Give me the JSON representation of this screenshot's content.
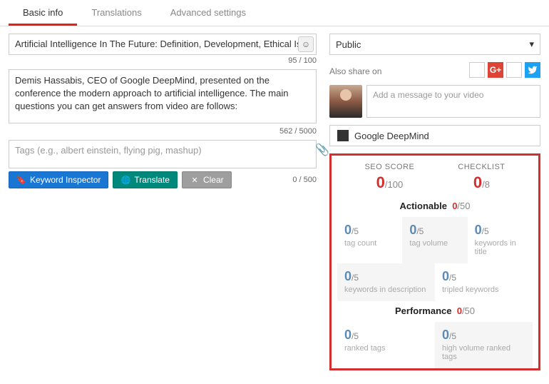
{
  "tabs": {
    "basic": "Basic info",
    "translations": "Translations",
    "advanced": "Advanced settings"
  },
  "title": {
    "value": "Artificial Intelligence In The Future: Definition, Development, Ethical Is",
    "counter": "95 / 100"
  },
  "description": {
    "value": "Demis Hassabis, CEO of Google DeepMind, presented on the conference the modern approach to artificial intelligence. The main questions you can get answers from video are follows:",
    "counter": "562 / 5000"
  },
  "tags": {
    "placeholder": "Tags (e.g., albert einstein, flying pig, mashup)",
    "counter": "0 / 500"
  },
  "buttons": {
    "keyword": "Keyword Inspector",
    "translate": "Translate",
    "clear": "Clear"
  },
  "privacy": {
    "value": "Public"
  },
  "share": {
    "label": "Also share on",
    "msg_placeholder": "Add a message to your video",
    "gplus": "G+",
    "twitter": "t"
  },
  "card": {
    "label": "Google DeepMind"
  },
  "seo": {
    "score_label": "SEO SCORE",
    "score_num": "0",
    "score_den": "/100",
    "check_label": "CHECKLIST",
    "check_num": "0",
    "check_den": "/8",
    "actionable_label": "Actionable",
    "actionable_num": "0",
    "actionable_den": "/50",
    "performance_label": "Performance",
    "performance_num": "0",
    "performance_den": "/50",
    "metrics": {
      "tag_count": {
        "num": "0",
        "den": "/5",
        "lbl": "tag count"
      },
      "tag_volume": {
        "num": "0",
        "den": "/5",
        "lbl": "tag volume"
      },
      "kw_title": {
        "num": "0",
        "den": "/5",
        "lbl": "keywords in title"
      },
      "kw_desc": {
        "num": "0",
        "den": "/5",
        "lbl": "keywords in description"
      },
      "tripled": {
        "num": "0",
        "den": "/5",
        "lbl": "tripled keywords"
      },
      "ranked": {
        "num": "0",
        "den": "/5",
        "lbl": "ranked tags"
      },
      "high_vol": {
        "num": "0",
        "den": "/5",
        "lbl": "high volume ranked tags"
      }
    }
  }
}
